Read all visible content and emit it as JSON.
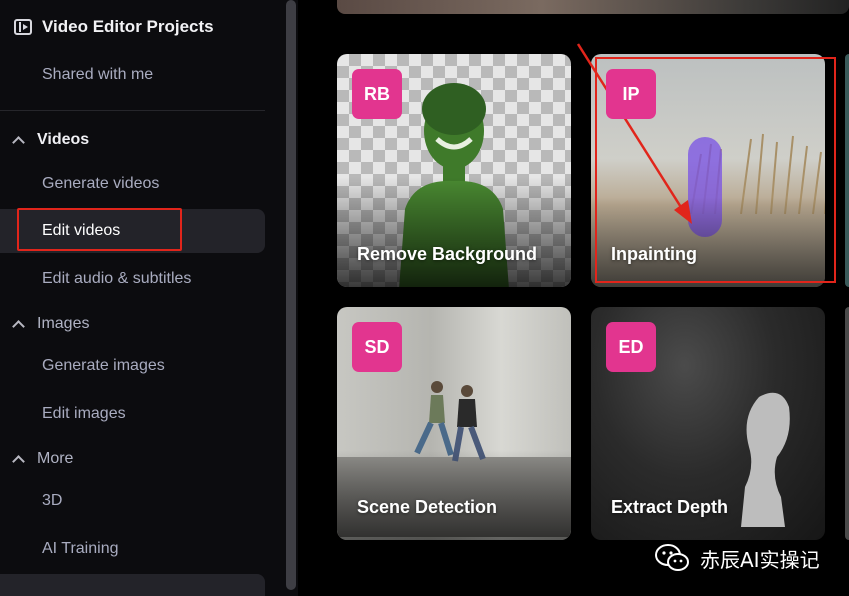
{
  "sidebar": {
    "project_title": "Video Editor Projects",
    "shared": "Shared with me",
    "sections": {
      "videos": "Videos",
      "images": "Images",
      "more": "More"
    },
    "items": {
      "generate_videos": "Generate videos",
      "edit_videos": "Edit videos",
      "edit_audio": "Edit audio & subtitles",
      "generate_images": "Generate images",
      "edit_images": "Edit images",
      "three_d": "3D",
      "ai_training": "AI Training"
    },
    "active_item": "Edit videos"
  },
  "tools": [
    {
      "badge": "RB",
      "label": "Remove Background"
    },
    {
      "badge": "IP",
      "label": "Inpainting"
    },
    {
      "badge": "SD",
      "label": "Scene Detection"
    },
    {
      "badge": "ED",
      "label": "Extract Depth"
    }
  ],
  "icons": {
    "project": "film-editor-icon",
    "section_toggle": "chevron-up-icon",
    "watermark": "wechat-icon"
  },
  "colors": {
    "badge": "#e2358f",
    "annotation": "#e1251b",
    "sidebar_bg": "#0c0c0f",
    "active_bg": "#232329"
  },
  "watermark": {
    "text": "赤辰AI实操记"
  }
}
